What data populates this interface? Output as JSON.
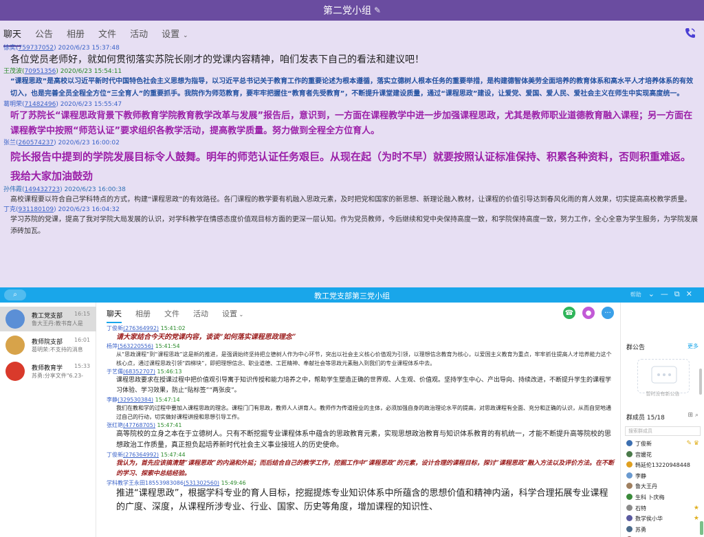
{
  "win1": {
    "title": "第二党小组",
    "edit_icon": "pencil-icon",
    "tabs": [
      {
        "label": "聊天",
        "active": true
      },
      {
        "label": "公告"
      },
      {
        "label": "相册"
      },
      {
        "label": "文件"
      },
      {
        "label": "活动"
      },
      {
        "label": "设置",
        "dropdown": true
      }
    ],
    "messages": [
      {
        "name": "徐奕",
        "uid": "759737052",
        "time": "2020/6/23 15:37:48",
        "meta_color": "#3a62c8",
        "text": "各位党员老师好，就如何贯彻落实苏院长刚才的党课内容精神，咱们发表下自己的看法和建议吧！",
        "text_color": "#222222",
        "font_size": 14,
        "line_height": 22,
        "bold": false,
        "indent": 10
      },
      {
        "name": "王茂波",
        "uid": "70951356",
        "time": "2020/6/23 15:54:11",
        "meta_color": "#2a8a2a",
        "text": "“课程思政”是高校以习近平新时代中国特色社会主义思想为指导，以习近平总书记关于教育工作的重要论述为根本遵循，落实立德树人根本任务的重要举措，是构建德智体美劳全面培养的教育体系和高水平人才培养体系的有效切入，也是完善全员全程全方位“三全育人”的重要抓手。我院作为师范教育，要牢牢把握住“教育者先受教育”，不断提升课堂建设质量，通过“课程思政”建设，让爱党、爱国、爱人民、爱社会主义在师生中实现高度统一。",
        "text_color": "#2150a0",
        "font_size": 10,
        "line_height": 18,
        "bold": true,
        "indent": 10
      },
      {
        "name": "葛明荣",
        "uid": "71482496",
        "time": "2020/6/23 15:55:47",
        "meta_color": "#3a62c8",
        "text": "听了苏院长“课程思政背景下教师教育学院教育教学改革与发展”报告后，意识到，一方面在课程教学中进一步加强课程思政，尤其是教师职业道德教育融入课程；另一方面在课程教学中按照“师范认证”要求组织各教学活动，提高教学质量。努力做到全程全方位育人。",
        "text_color": "#9b1fa8",
        "font_size": 13,
        "line_height": 22,
        "bold": true,
        "indent": 10
      },
      {
        "name": "张兰",
        "uid": "260574237",
        "time": "2020/6/23 16:00:02",
        "meta_color": "#3a62c8",
        "text": "院长报告中提到的学院发展目标令人鼓舞。明年的师范认证任务艰巨。从现在起（为时不早）就要按照认证标准保持、积累各种资料，否则积重难返。我给大家加油鼓劲",
        "text_color": "#9b1fa8",
        "font_size": 15,
        "line_height": 28,
        "bold": true,
        "indent": 10
      },
      {
        "name": "孙伟霞",
        "uid": "149432723",
        "time": "2020/6/23 16:00:38",
        "meta_color": "#2d6fb5",
        "text": "高校课程要以符合自己学科特点的方式，构建“课程思政”的有效路径。各门课程的教学要有机融入思政元素，及时把党和国家的新思想、新理论融入教材，让课程的价值引导达到春风化雨的育人效果，切实提高高校教学质量。",
        "text_color": "#333333",
        "font_size": 10,
        "line_height": 17,
        "bold": false,
        "indent": 10
      },
      {
        "name": "丁克",
        "uid": "931180109",
        "time": "2020/6/23 16:04:32",
        "meta_color": "#3a62c8",
        "text": "学习苏院的党课，提高了我对学院大局发展的认识，对学科教学在情感态度价值观目标方面的更深一层认知。作为党员教师，今后继续和党中央保持高度一致，和学院保持高度一致，努力工作，全心全意为学生服务，为学院发展添砖加瓦。",
        "text_color": "#333333",
        "font_size": 10,
        "line_height": 17,
        "bold": false,
        "indent": 10
      }
    ]
  },
  "win2": {
    "title": "教工党支部第三党小组",
    "search_icon": "search-icon",
    "window_controls": {
      "badge": "帮助",
      "icons": [
        "chevron-down-icon",
        "minimize-icon",
        "maximize-icon",
        "close-icon"
      ]
    },
    "conversations": [
      {
        "name": "教工党支部",
        "time": "16:15",
        "preview": "鲁大王丹:教书育人是",
        "avatar_color": "#5b8fd6",
        "selected": true
      },
      {
        "name": "教师院支部",
        "time": "16:01",
        "preview": "葛明荣:不支持的消息",
        "avatar_color": "#d7a34a"
      },
      {
        "name": "教师教育学",
        "time": "15:33",
        "preview": "苏勇:分享文件\"6.23-",
        "avatar_color": "#d93a2b"
      }
    ],
    "tabs": [
      {
        "label": "聊天",
        "active": true
      },
      {
        "label": "相册"
      },
      {
        "label": "文件"
      },
      {
        "label": "活动"
      },
      {
        "label": "设置",
        "dropdown": true
      }
    ],
    "actions": [
      {
        "name": "phone-icon",
        "color": "#2fb55a"
      },
      {
        "name": "video-icon",
        "color": "#c25ad6"
      },
      {
        "name": "more-icon",
        "color": "#3aa0e8"
      }
    ],
    "messages": [
      {
        "name": "丁俊新",
        "uid": "276364992",
        "time": "15:41:02",
        "text": "请大家结合今天的党课内容，谈谈“如何落实课程思政理念”",
        "text_color": "#9a1a1a",
        "font_size": 10,
        "line_height": 15,
        "bold": true,
        "italic": true,
        "indent": 14
      },
      {
        "name": "杨萍",
        "uid": "563220556",
        "time": "15:41:54",
        "text": "从“思政课程”到“课程思政”这是新的推进，是强调始终坚持把立德树人作为中心环节，突出以社会主义核心价值观为引领，以理想信念教育为核心，以爱国主义教育为重点，牢牢抓住提高人才培养能力这个核心点，通过课程思政引领“四梯块”，即把理想信念、职业道德、工匠精神、奉献社会等思政元素融入到我们的专业课程体系中去。",
        "text_color": "#333333",
        "font_size": 8,
        "line_height": 13,
        "bold": false,
        "italic": false,
        "indent": 14
      },
      {
        "name": "于艺儒",
        "uid": "68352707",
        "time": "15:46:13",
        "text": "课程思政要求在授课过程中把价值观引导寓于知识传授和能力培养之中，帮助学生塑造正确的世界观、人生观、价值观。坚持学生中心、产出导向、持续改进，不断提升学生的课程学习体验、学习效果，防止“贴标签”“两张皮”。",
        "text_color": "#222222",
        "font_size": 9,
        "line_height": 15,
        "bold": false,
        "italic": false,
        "indent": 14
      },
      {
        "name": "李静",
        "uid": "329530384",
        "time": "15:47:14",
        "text": "我们在教和学的过程中要加入课程思政的理念。课程门门有思政，教师人人讲育人。教师作为传道授业的主体，必须加强自身的政治理论水平的提高，对思政课程有全面、充分和正确的认识，从而自觉地通过自己的行动，切实做好课程讲授和思想引导工作。",
        "text_color": "#222222",
        "font_size": 8,
        "line_height": 13,
        "bold": false,
        "italic": false,
        "indent": 14
      },
      {
        "name": "张红艳",
        "uid": "47768705",
        "time": "15:47:41",
        "text": "高等院校的立身之本在于立德树人。只有不断挖掘专业课程体系中蕴含的思政教育元素，实现思想政治教育与知识体系教育的有机统一，才能不断提升高等院校的思想政治工作质量，真正担负起培养新时代社会主义事业接班人的历史使命。",
        "text_color": "#222222",
        "font_size": 10,
        "line_height": 16,
        "bold": false,
        "italic": false,
        "indent": 14
      },
      {
        "name": "丁俊新",
        "uid": "276364992",
        "time": "15:47:44",
        "text": "我认为，首先应该搞清楚“课程思政”的内涵和外延；而后结合自己的教学工作，挖掘工作中“课程思政”的元素，设计合理的课程目标，探讨“课程思政”融入方法以及评价方法。在不断的学习、探索中总结经验。",
        "text_color": "#9a1a1a",
        "font_size": 9,
        "line_height": 15,
        "bold": true,
        "italic": true,
        "indent": 14
      },
      {
        "name": "学科教学王永田18553983086",
        "uid": "531302560",
        "time": "15:49:46",
        "text": "推进“课程思政”，根据学科专业的育人目标，挖掘提炼专业知识体系中所蕴含的思想价值和精神内涵，科学合理拓展专业课程的广度、深度，从课程所涉专业、行业、国家、历史等角度，增加课程的知识性、",
        "text_color": "#222222",
        "font_size": 13,
        "line_height": 20,
        "bold": false,
        "italic": false,
        "indent": 14
      }
    ],
    "notice": {
      "title": "群公告",
      "more": "更多",
      "empty": "暂时没有新公告"
    },
    "members": {
      "title": "群成员 15/18",
      "search_placeholder": "搜索群成员",
      "list": [
        {
          "name": "丁俊新",
          "color": "#3c6fb0",
          "star": "edit-and-owner-icons"
        },
        {
          "name": "宫媛花",
          "color": "#4a7a4a"
        },
        {
          "name": "韩延伦13220948448",
          "color": "#e0a020"
        },
        {
          "name": "李静",
          "color": "#6a9ad0"
        },
        {
          "name": "鲁大王丹",
          "color": "#a08060"
        },
        {
          "name": "生科 卜庆梅",
          "color": "#3a8a3a"
        },
        {
          "name": "石特",
          "color": "#8a8a8a",
          "star": "star-icon"
        },
        {
          "name": "数学侯小华",
          "color": "#5a5aa0",
          "star": "star-icon"
        },
        {
          "name": "苏勇",
          "color": "#4a6a8a"
        },
        {
          "name": "王素霞",
          "color": "#7a4a4a"
        }
      ]
    }
  }
}
